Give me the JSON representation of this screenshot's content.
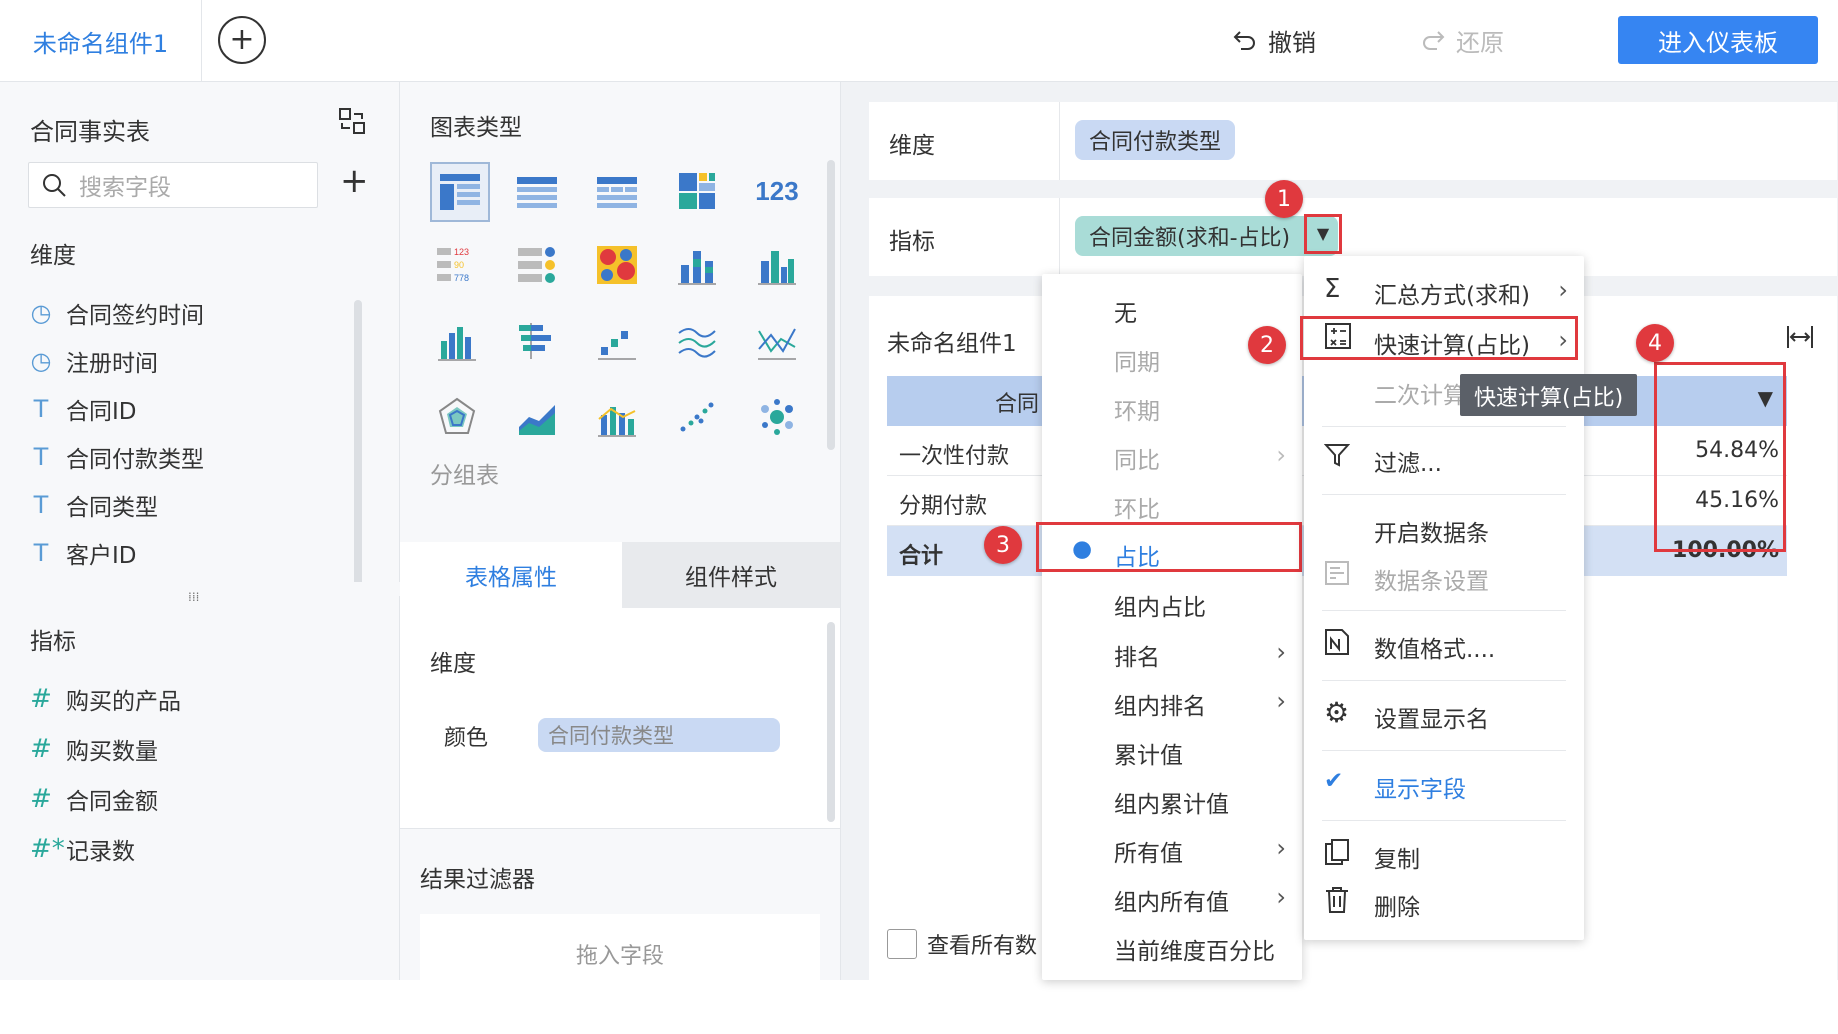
{
  "topbar": {
    "tab_label": "未命名组件1",
    "undo_label": "撤销",
    "redo_label": "还原",
    "enter_label": "进入仪表板"
  },
  "left": {
    "table_name": "合同事实表",
    "search_placeholder": "搜索字段",
    "dims_title": "维度",
    "dimensions": [
      "合同签约时间",
      "注册时间",
      "合同ID",
      "合同付款类型",
      "合同类型",
      "客户ID"
    ],
    "measures_title": "指标",
    "measures": [
      "购买的产品",
      "购买数量",
      "合同金额",
      "记录数"
    ]
  },
  "mid": {
    "chart_type_title": "图表类型",
    "chart_hint": "分组表",
    "tab_table_props": "表格属性",
    "tab_component_style": "组件样式",
    "dimension_label": "维度",
    "color_label": "颜色",
    "color_chip": "合同付款类型",
    "result_filter": "结果过滤器",
    "drop_field": "拖入字段"
  },
  "config": {
    "dim_label": "维度",
    "dim_chip": "合同付款类型",
    "measure_label": "指标",
    "measure_chip": "合同金额(求和-占比)"
  },
  "component": {
    "title": "未命名组件1",
    "header_col1": "合同",
    "rows": [
      {
        "name": "一次性付款",
        "value": "54.84%"
      },
      {
        "name": "分期付款",
        "value": "45.16%"
      }
    ],
    "total_label": "合计",
    "total_value": "100.00%",
    "view_all": "查看所有数"
  },
  "submenu": {
    "items": [
      "无",
      "同期",
      "环期",
      "同比",
      "环比",
      "占比",
      "组内占比",
      "排名",
      "组内排名",
      "累计值",
      "组内累计值",
      "所有值",
      "组内所有值",
      "当前维度百分比"
    ]
  },
  "menu": {
    "summary": "汇总方式(求和)",
    "quick_calc": "快速计算(占比)",
    "second_calc": "二次计算",
    "filter": "过滤...",
    "databar_on": "开启数据条",
    "databar_settings": "数据条设置",
    "number_format": "数值格式....",
    "display_name": "设置显示名",
    "show_field": "显示字段",
    "copy": "复制",
    "delete": "删除"
  },
  "tooltip": "快速计算(占比)",
  "badges": [
    "1",
    "2",
    "3",
    "4"
  ],
  "colors": {
    "accent": "#3685f2",
    "red": "#e0393e",
    "teal_chip": "#a9dcd7",
    "blue_chip": "#c9d9f3"
  }
}
